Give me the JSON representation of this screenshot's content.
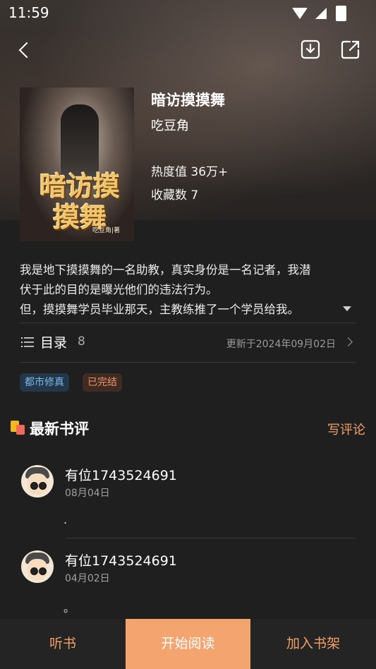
{
  "status_bar": {
    "time": "11:59"
  },
  "book": {
    "title": "暗访摸摸舞",
    "author": "吃豆角",
    "heat": "热度值 36万+",
    "collect": "收藏数 7",
    "cover_title": "暗访摸摸舞",
    "cover_author": "吃豆角|著"
  },
  "description": {
    "lines": [
      "我是地下摸摸舞的一名助教，真实身份是一名记者，我潜",
      "伏于此的目的是曝光他们的违法行为。",
      "但，摸摸舞学员毕业那天，主教练推了一个学员给我。"
    ]
  },
  "toc": {
    "label": "目录",
    "count": "8",
    "updated": "更新于2024年09月02日"
  },
  "tags": [
    {
      "label": "都市修真"
    },
    {
      "label": "已完结"
    }
  ],
  "reviews_section": {
    "title": "最新书评",
    "write_label": "写评论"
  },
  "reviews": [
    {
      "user": "有位1743524691",
      "date": "08月04日",
      "text": "."
    },
    {
      "user": "有位1743524691",
      "date": "04月02日",
      "text": "。"
    }
  ],
  "bottom": {
    "listen": "听书",
    "read": "开始阅读",
    "shelf": "加入书架"
  },
  "colors": {
    "accent": "#f3a46f",
    "background": "#1f1f1f"
  },
  "icons": [
    "back-icon",
    "download-icon",
    "share-icon",
    "list-icon",
    "chevron-right-icon",
    "expand-arrow-icon"
  ]
}
